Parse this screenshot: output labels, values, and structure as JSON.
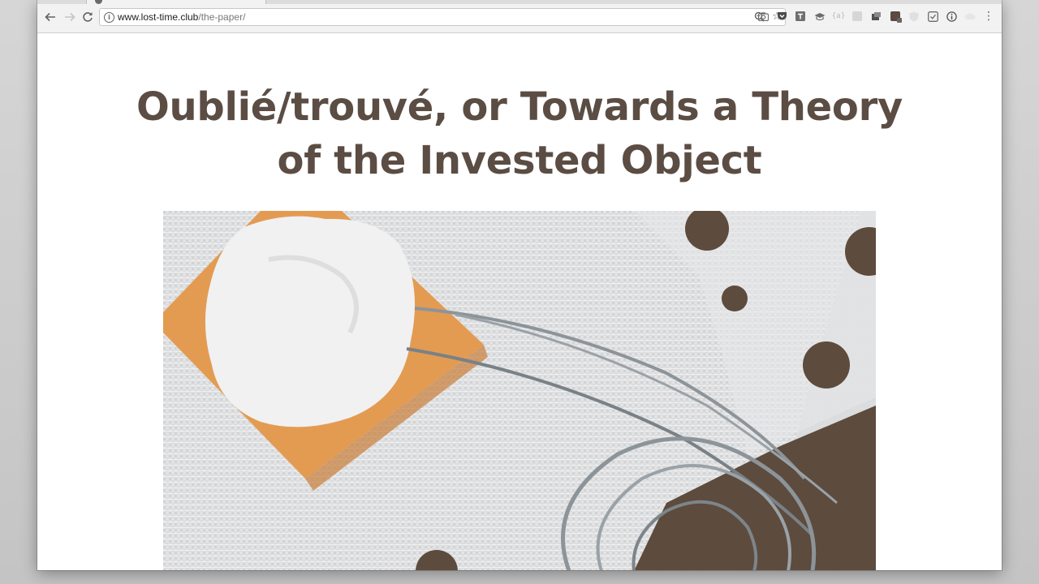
{
  "browser": {
    "back_icon": "arrow-left-icon",
    "forward_icon": "arrow-right-icon",
    "reload_icon": "reload-icon",
    "url": {
      "host": "www.lost-time.club",
      "path": "/the-paper/"
    },
    "omnibox_icons": [
      "zoom-icon",
      "star-icon"
    ],
    "extension_icons": [
      "camera-icon",
      "pocket-icon",
      "text-icon",
      "graduation-cap-icon",
      "bracket-icon",
      "puzzle-icon",
      "stamp-icon",
      "box-icon",
      "shield-icon",
      "frame-icon",
      "info-icon",
      "cloud-icon",
      "menu-icon"
    ],
    "menu_glyph": "⋮"
  },
  "article": {
    "title": "Oublié/trouvé, or Towards a Theory of the Invested Object"
  },
  "colors": {
    "title": "#5b4d43",
    "brown": "#5d4b3e",
    "orange": "#e39b52",
    "paper": "#e2e3e4",
    "white": "#f4f4f4",
    "wire": "#8c9499"
  }
}
